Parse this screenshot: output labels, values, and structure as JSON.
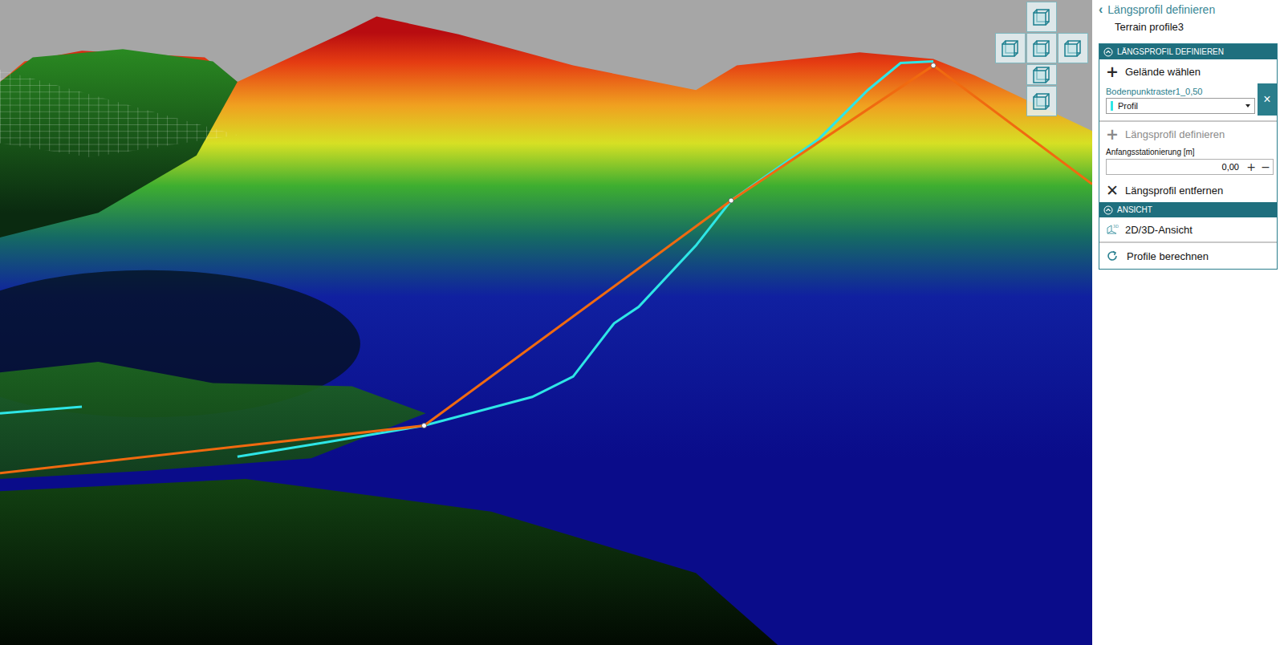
{
  "panel": {
    "back": {
      "icon": "‹",
      "label": "Längsprofil definieren"
    },
    "subtitle": "Terrain profile3",
    "sections": [
      {
        "title": "LÄNGSPROFIL DEFINIEREN",
        "expanded": true,
        "items": [
          {
            "kind": "action",
            "icon": "+",
            "label": "Gelände wählen",
            "disabled": false
          },
          {
            "kind": "terrain",
            "label": "Bodenpunktraster1_0,50",
            "value": "Profil",
            "color": "#2ee6e6",
            "remove_icon": "×"
          },
          {
            "kind": "action",
            "icon": "+",
            "label": "Längsprofil definieren",
            "disabled": true
          },
          {
            "kind": "field",
            "label": "Anfangsstationierung [m]",
            "value": "0,00",
            "buttons": [
              "+",
              "−"
            ]
          },
          {
            "kind": "action",
            "icon": "✕",
            "label": "Längsprofil entfernen",
            "disabled": false
          }
        ]
      },
      {
        "title": "ANSICHT",
        "expanded": true,
        "items": [
          {
            "kind": "view",
            "label": "2D/3D-Ansicht"
          }
        ]
      }
    ],
    "footer": {
      "label": "Profile berechnen"
    }
  }
}
